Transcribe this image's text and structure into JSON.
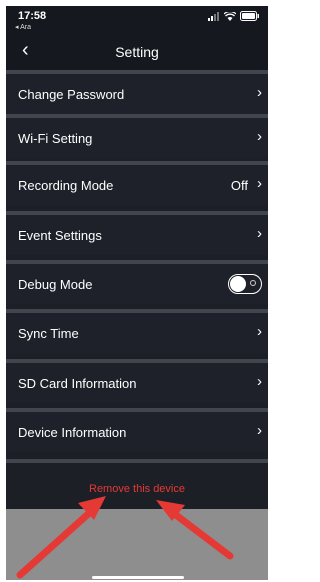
{
  "status_bar": {
    "time": "17:58",
    "back_app": "◂ Ara",
    "icons": [
      "signal-icon",
      "wifi-icon",
      "battery-icon"
    ]
  },
  "nav": {
    "back_icon": "chevron-left-icon",
    "title": "Setting"
  },
  "settings": {
    "change_password": "Change Password",
    "wifi_setting": "Wi-Fi Setting",
    "recording_mode": "Recording Mode",
    "recording_mode_value": "Off",
    "event_settings": "Event Settings",
    "debug_mode": "Debug Mode",
    "debug_mode_enabled": false,
    "sync_time": "Sync Time",
    "sd_card_information": "SD Card Information",
    "device_information": "Device Information"
  },
  "remove_device": "Remove this device",
  "colors": {
    "background": "#1c1f26",
    "separator": "#41454d",
    "danger": "#e53935",
    "annotation_arrow": "#e53935"
  }
}
